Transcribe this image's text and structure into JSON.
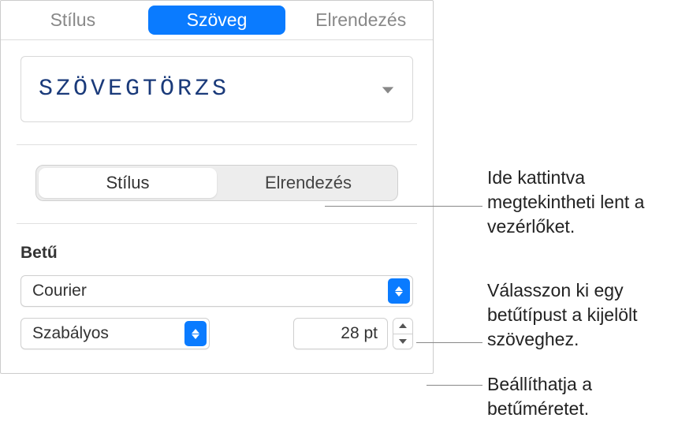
{
  "topTabs": {
    "style": "Stílus",
    "text": "Szöveg",
    "layout": "Elrendezés"
  },
  "paragraphStyle": {
    "label": "Szövegtörzs"
  },
  "segments": {
    "style": "Stílus",
    "layout": "Elrendezés"
  },
  "font": {
    "sectionLabel": "Betű",
    "family": "Courier",
    "weight": "Szabályos",
    "size": "28 pt"
  },
  "callouts": {
    "seeControls": "Ide kattintva megtekintheti lent a vezérlőket.",
    "chooseFont": "Válasszon ki egy betűtípust a kijelölt szöveghez.",
    "setSize": "Beállíthatja a betűméretet."
  }
}
